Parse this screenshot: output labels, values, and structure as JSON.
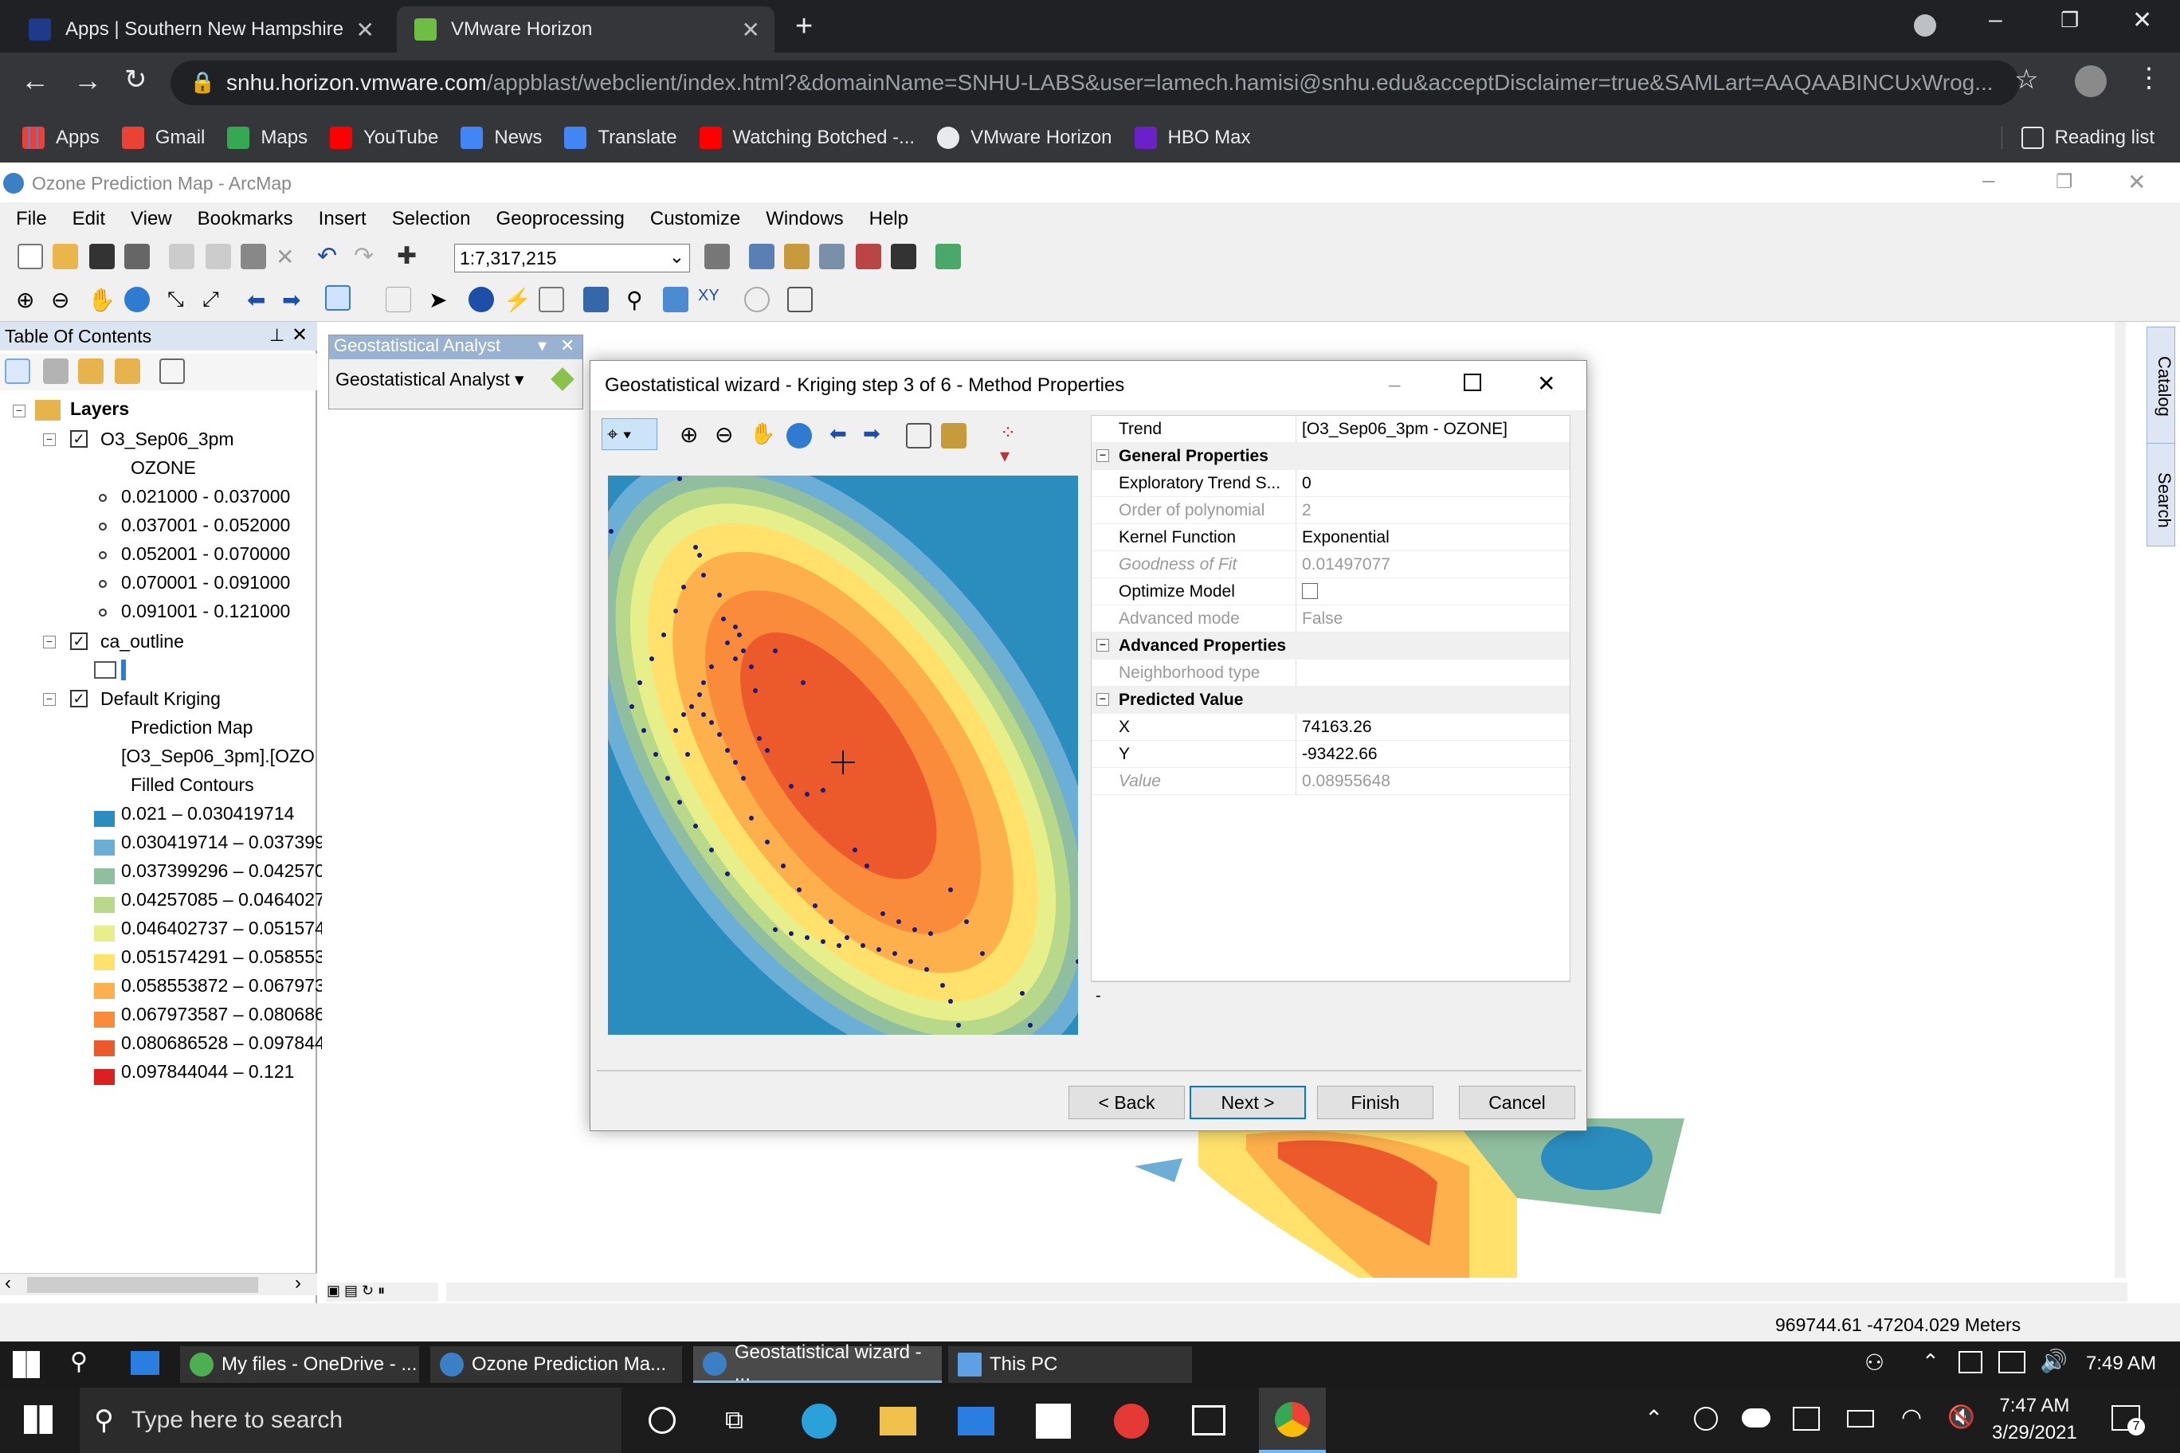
{
  "browser": {
    "tabs": [
      {
        "label": "Apps | Southern New Hampshire"
      },
      {
        "label": "VMware Horizon"
      }
    ],
    "url_host": "snhu.horizon.vmware.com",
    "url_path": "/appblast/webclient/index.html?&domainName=SNHU-LABS&user=lamech.hamisi@snhu.edu&acceptDisclaimer=true&SAMLart=AAQAABINCUxWrog...",
    "bookmarks": [
      "Apps",
      "Gmail",
      "Maps",
      "YouTube",
      "News",
      "Translate",
      "Watching Botched -...",
      "VMware Horizon",
      "HBO Max"
    ],
    "reading_list": "Reading list"
  },
  "arcmap": {
    "title": "Ozone Prediction Map - ArcMap",
    "menu": [
      "File",
      "Edit",
      "View",
      "Bookmarks",
      "Insert",
      "Selection",
      "Geoprocessing",
      "Customize",
      "Windows",
      "Help"
    ],
    "scale": "1:7,317,215",
    "toc_title": "Table Of Contents",
    "layers_label": "Layers",
    "layer1": {
      "name": "O3_Sep06_3pm",
      "field": "OZONE",
      "classes": [
        "0.021000 - 0.037000",
        "0.037001 - 0.052000",
        "0.052001 - 0.070000",
        "0.070001 - 0.091000",
        "0.091001 - 0.121000"
      ]
    },
    "layer2": {
      "name": "ca_outline"
    },
    "layer3": {
      "name": "Default Kriging",
      "sub1": "Prediction Map",
      "sub2": "[O3_Sep06_3pm].[OZO",
      "sub3": "Filled Contours",
      "classes": [
        "0.021 – 0.030419714",
        "0.030419714 – 0.037399",
        "0.037399296 – 0.042570",
        "0.04257085 – 0.0464027",
        "0.046402737 – 0.051574",
        "0.051574291 – 0.058553",
        "0.058553872 – 0.067973",
        "0.067973587 – 0.080686",
        "0.080686528 – 0.097844",
        "0.097844044 – 0.121"
      ],
      "colors": [
        "#2b8cbe",
        "#6baed6",
        "#8fbf9f",
        "#b8d98a",
        "#e6ef8a",
        "#ffe16b",
        "#fdb04b",
        "#f98b3a",
        "#ec5a2c",
        "#de1f1f"
      ]
    },
    "ga_toolbar_title": "Geostatistical Analyst",
    "ga_toolbar_menu": "Geostatistical Analyst",
    "coords": "969744.61  -47204.029 Meters",
    "catalog_tab": "Catalog",
    "search_tab": "Search"
  },
  "wizard": {
    "title": "Geostatistical wizard - Kriging step 3 of 6 - Method Properties",
    "props": [
      {
        "k": "Trend",
        "v": "[O3_Sep06_3pm - OZONE]",
        "type": "row"
      },
      {
        "k": "General Properties",
        "v": "",
        "type": "cat"
      },
      {
        "k": "Exploratory Trend S...",
        "v": "0",
        "type": "row"
      },
      {
        "k": "Order of polynomial",
        "v": "2",
        "type": "dis"
      },
      {
        "k": "Kernel Function",
        "v": "Exponential",
        "type": "row"
      },
      {
        "k": "Goodness of Fit",
        "v": "0.01497077",
        "type": "dis"
      },
      {
        "k": "Optimize Model",
        "v": "",
        "type": "row"
      },
      {
        "k": "Advanced mode",
        "v": "False",
        "type": "dis"
      },
      {
        "k": "Advanced Properties",
        "v": "",
        "type": "cat"
      },
      {
        "k": "Neighborhood type",
        "v": "",
        "type": "dis"
      },
      {
        "k": "Predicted Value",
        "v": "",
        "type": "cat"
      },
      {
        "k": "X",
        "v": "74163.26",
        "type": "row"
      },
      {
        "k": "Y",
        "v": "-93422.66",
        "type": "row"
      },
      {
        "k": "Value",
        "v": "0.08955648",
        "type": "dis"
      }
    ],
    "desc": "-",
    "back": "< Back",
    "next": "Next >",
    "finish": "Finish",
    "cancel": "Cancel"
  },
  "vm_taskbar": {
    "apps": [
      "My files - OneDrive - ...",
      "Ozone Prediction Ma...",
      "Geostatistical wizard - ...",
      "This PC"
    ],
    "time": "7:49 AM"
  },
  "win_taskbar": {
    "search": "Type here to search",
    "time": "7:47 AM",
    "date": "3/29/2021",
    "badge": "7"
  }
}
